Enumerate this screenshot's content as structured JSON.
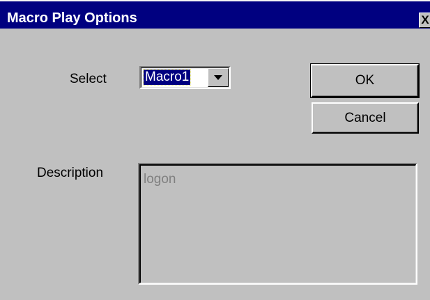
{
  "window": {
    "title": "Macro Play Options",
    "close_glyph": "X",
    "title_bar_color": "#000080",
    "face_color": "#c0c0c0"
  },
  "select": {
    "label": "Select",
    "value": "Macro1",
    "dropdown_icon": "chevron-down-icon"
  },
  "buttons": {
    "ok": "OK",
    "cancel": "Cancel"
  },
  "description": {
    "label": "Description",
    "value": "logon"
  }
}
